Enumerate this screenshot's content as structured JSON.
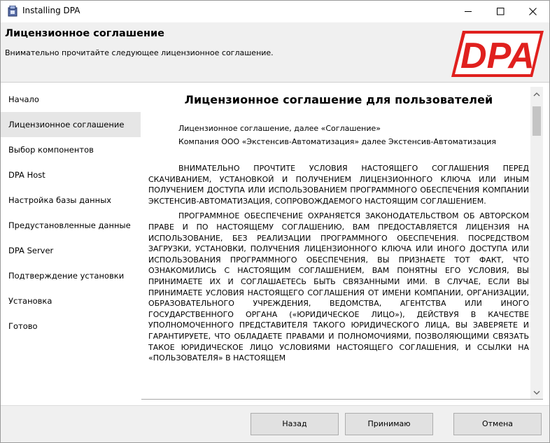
{
  "window": {
    "title": "Installing DPA"
  },
  "header": {
    "title": "Лицензионное соглашение",
    "subtitle": "Внимательно прочитайте следующее лицензионное соглашение.",
    "logo_text": "DPA",
    "logo_color": "#e0201e"
  },
  "sidebar": {
    "items": [
      {
        "label": "Начало",
        "active": false
      },
      {
        "label": "Лицензионное соглашение",
        "active": true
      },
      {
        "label": "Выбор компонентов",
        "active": false
      },
      {
        "label": "DPA Host",
        "active": false
      },
      {
        "label": "Настройка базы данных",
        "active": false
      },
      {
        "label": "Предустановленные данные",
        "active": false
      },
      {
        "label": "DPA Server",
        "active": false
      },
      {
        "label": "Подтверждение установки",
        "active": false
      },
      {
        "label": "Установка",
        "active": false
      },
      {
        "label": "Готово",
        "active": false
      }
    ]
  },
  "license": {
    "title": "Лицензионное соглашение для пользователей",
    "line1": "Лицензионное соглашение, далее «Соглашение»",
    "line2": "Компания ООО «Экстенсив-Автоматизация» далее Экстенсив-Автоматизация",
    "para1": "ВНИМАТЕЛЬНО ПРОЧТИТЕ УСЛОВИЯ НАСТОЯЩЕГО СОГЛАШЕНИЯ ПЕРЕД СКАЧИВАНИЕМ, УСТАНОВКОЙ И ПОЛУЧЕНИЕМ ЛИЦЕНЗИОННОГО КЛЮЧА ИЛИ ИНЫМ ПОЛУЧЕНИЕМ ДОСТУПА ИЛИ ИСПОЛЬЗОВАНИЕМ ПРОГРАММНОГО ОБЕСПЕЧЕНИЯ КОМПАНИИ ЭКСТЕНСИВ-АВТОМАТИЗАЦИЯ, СОПРОВОЖДАЕМОГО НАСТОЯЩИМ СОГЛАШЕНИЕМ.",
    "para2": "ПРОГРАММНОЕ ОБЕСПЕЧЕНИЕ ОХРАНЯЕТСЯ ЗАКОНОДАТЕЛЬСТВОМ ОБ АВТОРСКОМ ПРАВЕ И ПО НАСТОЯЩЕМУ СОГЛАШЕНИЮ, ВАМ ПРЕДОСТАВЛЯЕТСЯ ЛИЦЕНЗИЯ НА ИСПОЛЬЗОВАНИЕ, БЕЗ РЕАЛИЗАЦИИ ПРОГРАММНОГО ОБЕСПЕЧЕНИЯ. ПОСРЕДСТВОМ ЗАГРУЗКИ, УСТАНОВКИ, ПОЛУЧЕНИЯ ЛИЦЕНЗИОННОГО КЛЮЧА ИЛИ ИНОГО ДОСТУПА ИЛИ ИСПОЛЬЗОВАНИЯ ПРОГРАММНОГО ОБЕСПЕЧЕНИЯ, ВЫ ПРИЗНАЕТЕ ТОТ ФАКТ, ЧТО ОЗНАКОМИЛИСЬ С НАСТОЯЩИМ СОГЛАШЕНИЕМ, ВАМ ПОНЯТНЫ ЕГО УСЛОВИЯ, ВЫ ПРИНИМАЕТЕ ИХ И СОГЛАШАЕТЕСЬ БЫТЬ СВЯЗАННЫМИ ИМИ. В СЛУЧАЕ, ЕСЛИ ВЫ ПРИНИМАЕТЕ УСЛОВИЯ НАСТОЯЩЕГО СОГЛАШЕНИЯ ОТ ИМЕНИ КОМПАНИИ, ОРГАНИЗАЦИИ, ОБРАЗОВАТЕЛЬНОГО УЧРЕЖДЕНИЯ, ВЕДОМСТВА, АГЕНТСТВА ИЛИ ИНОГО ГОСУДАРСТВЕННОГО ОРГАНА («ЮРИДИЧЕСКОЕ ЛИЦО»), ДЕЙСТВУЯ В КАЧЕСТВЕ УПОЛНОМОЧЕННОГО ПРЕДСТАВИТЕЛЯ ТАКОГО ЮРИДИЧЕСКОГО ЛИЦА, ВЫ ЗАВЕРЯЕТЕ И ГАРАНТИРУЕТЕ, ЧТО ОБЛАДАЕТЕ ПРАВАМИ И ПОЛНОМОЧИЯМИ, ПОЗВОЛЯЮЩИМИ СВЯЗАТЬ ТАКОЕ ЮРИДИЧЕСКОЕ ЛИЦО УСЛОВИЯМИ НАСТОЯЩЕГО СОГЛАШЕНИЯ, И ССЫЛКИ НА «ПОЛЬЗОВАТЕЛЯ» В НАСТОЯЩЕМ"
  },
  "footer": {
    "back_label": "Назад",
    "accept_label": "Принимаю",
    "cancel_label": "Отмена"
  }
}
